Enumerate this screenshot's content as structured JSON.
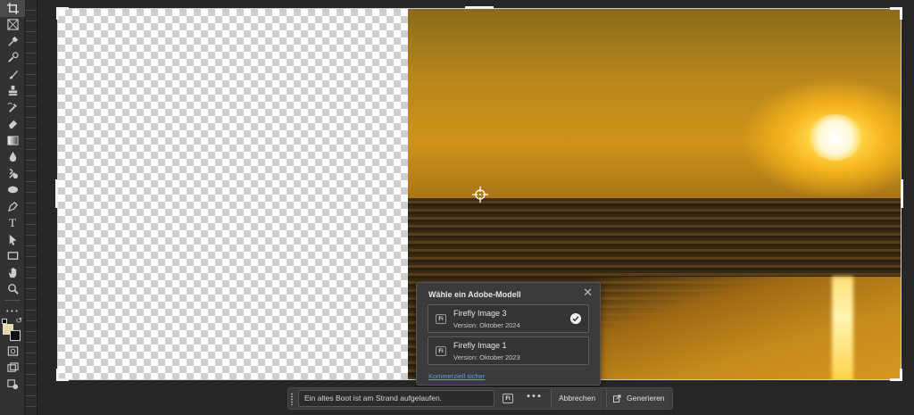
{
  "toolbar": {
    "tools": [
      "crop-icon",
      "frame-icon",
      "eyedropper-icon",
      "spot-healing-icon",
      "brush-icon",
      "clone-stamp-icon",
      "history-brush-icon",
      "eraser-icon",
      "gradient-icon",
      "blur-icon",
      "dodge-icon",
      "sponge-icon",
      "pen-icon",
      "type-icon",
      "path-select-icon",
      "rectangle-icon",
      "hand-icon",
      "zoom-icon",
      "more-tools-icon"
    ],
    "type_tool_glyph": "T",
    "more_glyph": "•••",
    "foreground_color": "#e8d9a6",
    "background_color": "#111111"
  },
  "model_popup": {
    "title": "Wähle ein Adobe-Modell",
    "options": [
      {
        "name": "Firefly Image 3",
        "version": "Version: Oktober 2024",
        "selected": true,
        "badge": "Fi"
      },
      {
        "name": "Firefly Image 1",
        "version": "Version: Oktober 2023",
        "selected": false,
        "badge": "Fi"
      }
    ],
    "link": "Kommerziell sicher"
  },
  "prompt_bar": {
    "prompt_value": "Ein altes Boot ist am Strand aufgelaufen.",
    "model_badge": "Fi",
    "more_label": "•••",
    "cancel_label": "Abbrechen",
    "generate_label": "Generieren"
  },
  "colors": {
    "accent_link": "#5d9cec",
    "ui_background": "#262626",
    "panel": "#3b3b3b"
  }
}
